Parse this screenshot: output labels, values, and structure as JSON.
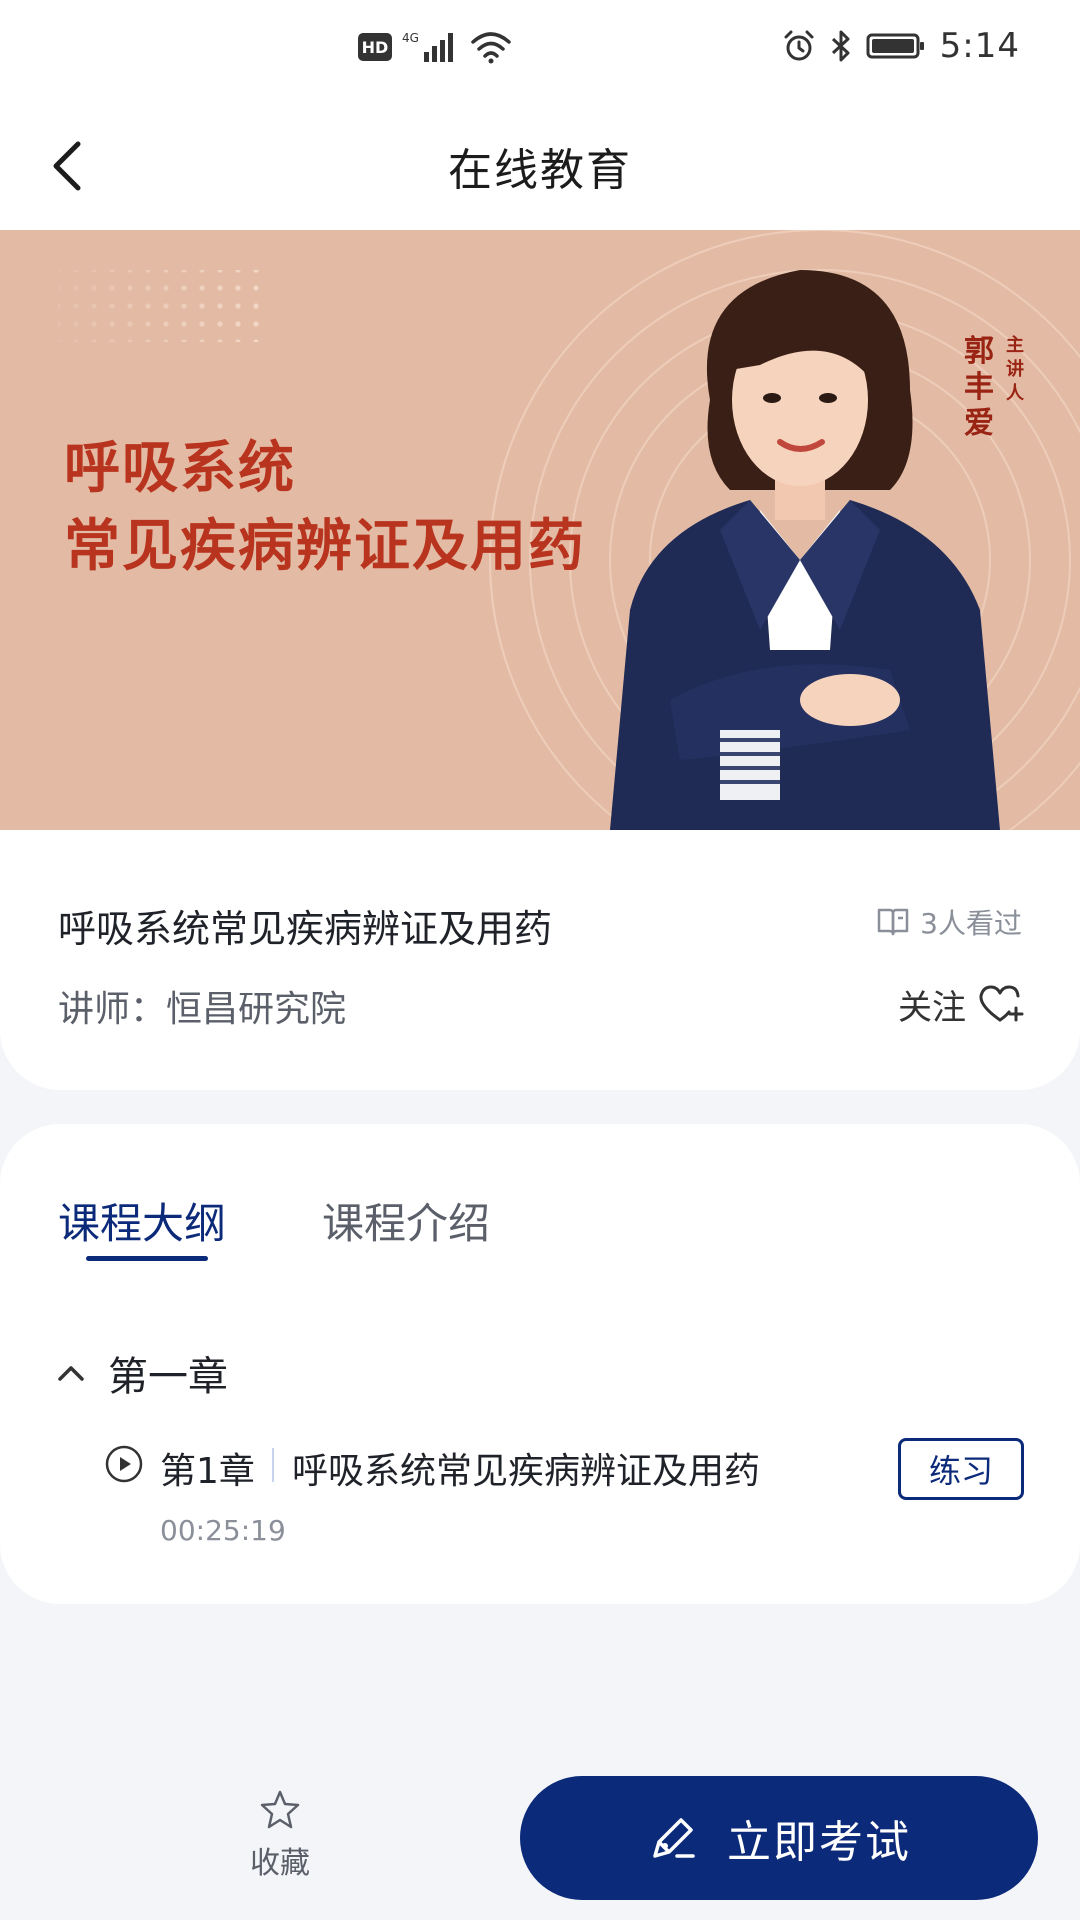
{
  "status_bar": {
    "network": "4G",
    "hd_badge": "HD",
    "time": "5:14",
    "icons": [
      "hd-icon",
      "signal-icon",
      "wifi-icon",
      "alarm-icon",
      "bluetooth-icon",
      "battery-icon"
    ]
  },
  "nav": {
    "title": "在线教育",
    "back_icon": "chevron-left-icon"
  },
  "banner": {
    "headline_line1": "呼吸系统",
    "headline_line2": "常见疾病辨证及用药",
    "speaker_name": "郭丰爱",
    "speaker_role": "主讲人",
    "accent_color": "#b8341f"
  },
  "course": {
    "title": "呼吸系统常见疾病辨证及用药",
    "viewers": "3人看过",
    "teacher": "讲师：恒昌研究院",
    "follow_label": "关注"
  },
  "tabs": [
    {
      "label": "课程大纲",
      "active": true
    },
    {
      "label": "课程介绍",
      "active": false
    }
  ],
  "outline": {
    "chapter_title": "第一章",
    "lessons": [
      {
        "label": "第1章",
        "name": "呼吸系统常见疾病辨证及用药",
        "duration": "00:25:19",
        "practice_label": "练习"
      }
    ]
  },
  "bottom_bar": {
    "favorite_label": "收藏",
    "exam_label": "立即考试",
    "primary_color": "#0c2a7a"
  }
}
